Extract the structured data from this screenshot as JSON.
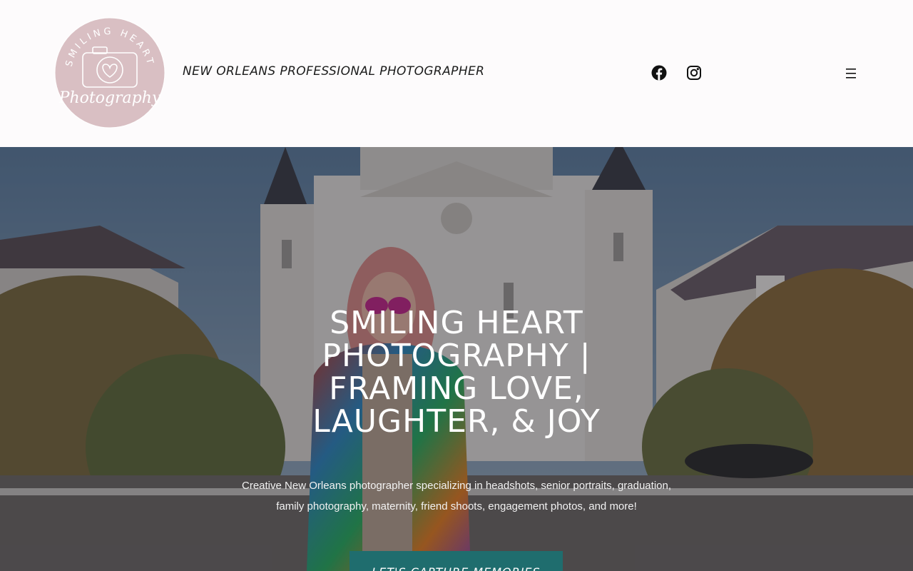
{
  "header": {
    "logo": {
      "arc_text": "SMILING HEART",
      "script_text": "Photography"
    },
    "tagline": "NEW ORLEANS PROFESSIONAL PHOTOGRAPHER",
    "social": [
      "facebook-icon",
      "instagram-icon"
    ],
    "menu_icon": "hamburger-menu-icon"
  },
  "hero": {
    "title_lines": [
      "SMILING HEART",
      "PHOTOGRAPHY |",
      "FRAMING LOVE,",
      "LAUGHTER, & JOY"
    ],
    "description_lines": [
      "Creative New Orleans photographer specializing in headshots, senior portraits, graduation,",
      "family photography, maternity, friend shoots, engagement photos, and more!"
    ],
    "cta_label": "LET'S CAPTURE MEMORIES"
  },
  "colors": {
    "header_bg": "#fdfbfc",
    "logo_pink": "#d9bfc3",
    "cta_teal": "#1f6d6e",
    "hero_text": "#ffffff"
  }
}
